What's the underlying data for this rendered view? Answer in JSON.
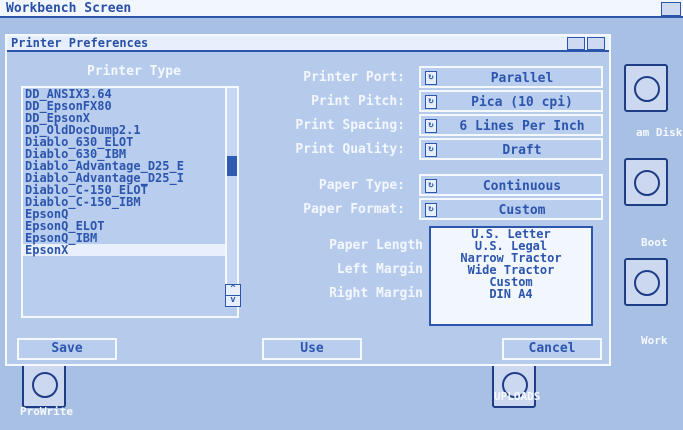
{
  "screen": {
    "title": "Workbench Screen"
  },
  "window": {
    "title": "Printer Preferences",
    "section_title": "Printer Type",
    "printers": [
      "DD_ANSIX3.64",
      "DD_EpsonFX80",
      "DD_EpsonX",
      "DD_OldDocDump2.1",
      "Diablo_630_ELOT",
      "Diablo_630_IBM",
      "Diablo_Advantage_D25_E",
      "Diablo_Advantage_D25_I",
      "Diablo_C-150_ELOT",
      "Diablo_C-150_IBM",
      "EpsonQ",
      "EpsonQ_ELOT",
      "EpsonQ_IBM",
      "EpsonX"
    ],
    "selected_printer": "EpsonX",
    "fields": {
      "printer_port": {
        "label": "Printer Port:",
        "value": "Parallel"
      },
      "print_pitch": {
        "label": "Print Pitch:",
        "value": "Pica (10 cpi)"
      },
      "print_spacing": {
        "label": "Print Spacing:",
        "value": "6 Lines Per Inch"
      },
      "print_quality": {
        "label": "Print Quality:",
        "value": "Draft"
      },
      "paper_type": {
        "label": "Paper Type:",
        "value": "Continuous"
      },
      "paper_format": {
        "label": "Paper Format:",
        "value": "Custom"
      }
    },
    "paper_format_options": [
      "U.S. Letter",
      "U.S. Legal",
      "Narrow Tractor",
      "Wide Tractor",
      "Custom",
      "DIN A4"
    ],
    "labels": {
      "paper_length": "Paper Length",
      "left_margin": "Left Margin",
      "right_margin": "Right Margin"
    },
    "buttons": {
      "save": "Save",
      "use": "Use",
      "cancel": "Cancel"
    }
  },
  "desktop": {
    "icons": [
      {
        "label": "am Disk"
      },
      {
        "label": "Boot"
      },
      {
        "label": "Work"
      },
      {
        "label": "ProWrite"
      },
      {
        "label": "UPLOADS"
      }
    ]
  }
}
